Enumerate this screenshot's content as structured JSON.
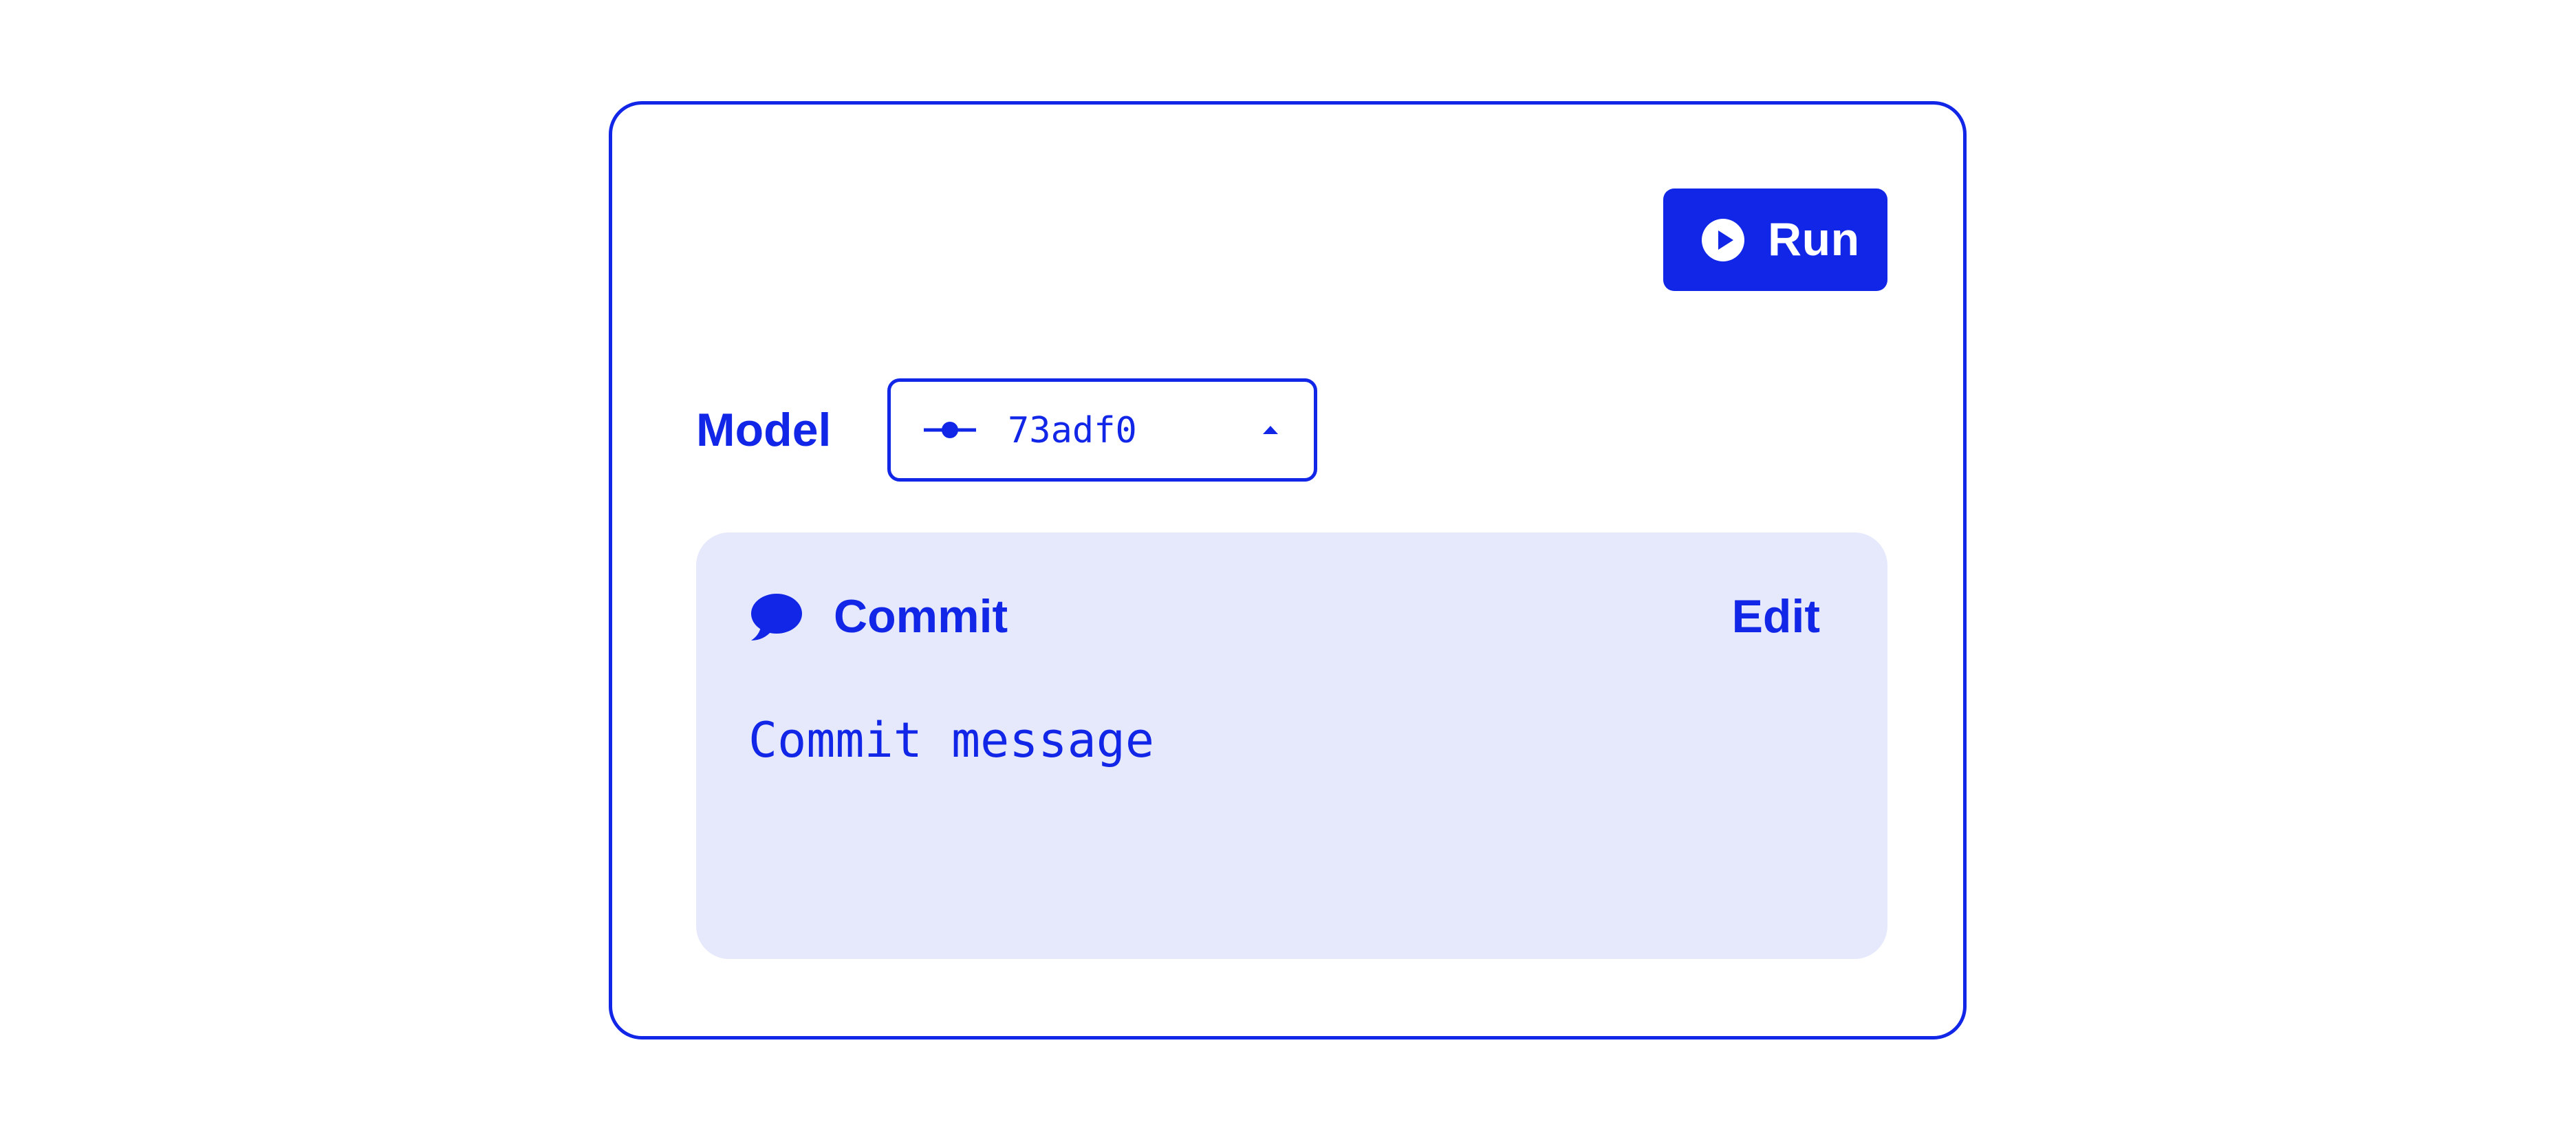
{
  "colors": {
    "accent": "#1126e6",
    "panel_background": "#e6e9fc",
    "background": "#ffffff"
  },
  "toolbar": {
    "run_label": "Run",
    "run_icon": "play-circle-icon"
  },
  "model": {
    "label": "Model",
    "selected_value": "73adf0",
    "icon": "git-commit-icon",
    "caret_icon": "caret-up-icon"
  },
  "commit": {
    "title": "Commit",
    "title_icon": "speech-bubble-icon",
    "edit_label": "Edit",
    "message_placeholder": "Commit message"
  }
}
